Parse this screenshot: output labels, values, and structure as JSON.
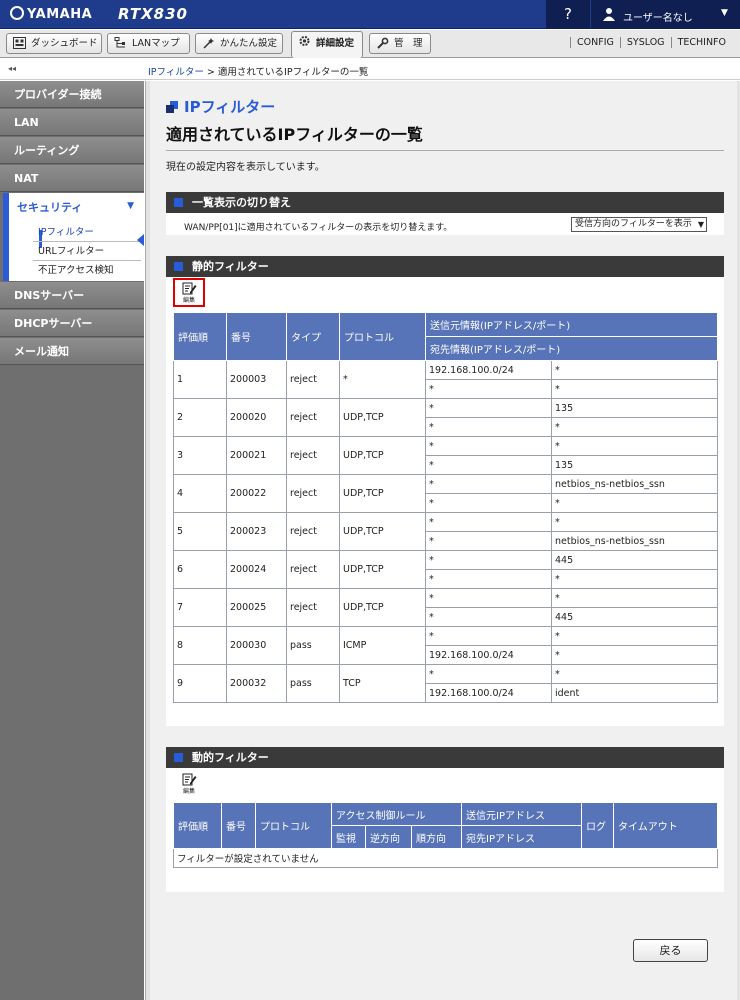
{
  "header": {
    "brand": "YAMAHA",
    "model": "RTX830",
    "help_label": "?",
    "user_name": "ユーザー名なし"
  },
  "tabs": [
    {
      "label": "ダッシュボード",
      "icon": "dashboard-icon"
    },
    {
      "label": "LANマップ",
      "icon": "lanmap-icon"
    },
    {
      "label": "かんたん設定",
      "icon": "wizard-icon"
    },
    {
      "label": "詳細設定",
      "icon": "gear-icon",
      "active": true
    },
    {
      "label": "管　理",
      "icon": "wrench-icon"
    }
  ],
  "top_links": [
    "CONFIG",
    "SYSLOG",
    "TECHINFO"
  ],
  "breadcrumb": {
    "link": "IPフィルター",
    "separator": " > ",
    "current": "適用されているIPフィルターの一覧"
  },
  "collapse_label": "◂◂",
  "sidebar": {
    "items": [
      {
        "label": "プロバイダー接続"
      },
      {
        "label": "LAN"
      },
      {
        "label": "ルーティング"
      },
      {
        "label": "NAT"
      },
      {
        "label": "DNSサーバー"
      },
      {
        "label": "DHCPサーバー"
      },
      {
        "label": "メール通知"
      }
    ],
    "security": {
      "label": "セキュリティ",
      "chevron": "▼",
      "sub_items": [
        "IPフィルター",
        "URLフィルター",
        "不正アクセス検知"
      ]
    }
  },
  "page": {
    "subtitle": "IPフィルター",
    "title": "適用されているIPフィルターの一覧",
    "description": "現在の設定内容を表示しています。"
  },
  "switch_section": {
    "title": "一覧表示の切り替え",
    "text": "WAN/PP[01]に適用されているフィルターの表示を切り替えます。",
    "select_value": "受信方向のフィルターを表示"
  },
  "static_section": {
    "title": "静的フィルター",
    "edit_label": "編集",
    "headers": {
      "order": "評価順",
      "number": "番号",
      "type": "タイプ",
      "protocol": "プロトコル",
      "src": "送信元情報(IPアドレス/ポート)",
      "dst": "宛先情報(IPアドレス/ポート)"
    },
    "rows": [
      {
        "order": "1",
        "number": "200003",
        "type": "reject",
        "protocol": "*",
        "src_ip": "192.168.100.0/24",
        "src_port": "*",
        "dst_ip": "*",
        "dst_port": "*"
      },
      {
        "order": "2",
        "number": "200020",
        "type": "reject",
        "protocol": "UDP,TCP",
        "src_ip": "*",
        "src_port": "135",
        "dst_ip": "*",
        "dst_port": "*"
      },
      {
        "order": "3",
        "number": "200021",
        "type": "reject",
        "protocol": "UDP,TCP",
        "src_ip": "*",
        "src_port": "*",
        "dst_ip": "*",
        "dst_port": "135"
      },
      {
        "order": "4",
        "number": "200022",
        "type": "reject",
        "protocol": "UDP,TCP",
        "src_ip": "*",
        "src_port": "netbios_ns-netbios_ssn",
        "dst_ip": "*",
        "dst_port": "*"
      },
      {
        "order": "5",
        "number": "200023",
        "type": "reject",
        "protocol": "UDP,TCP",
        "src_ip": "*",
        "src_port": "*",
        "dst_ip": "*",
        "dst_port": "netbios_ns-netbios_ssn"
      },
      {
        "order": "6",
        "number": "200024",
        "type": "reject",
        "protocol": "UDP,TCP",
        "src_ip": "*",
        "src_port": "445",
        "dst_ip": "*",
        "dst_port": "*"
      },
      {
        "order": "7",
        "number": "200025",
        "type": "reject",
        "protocol": "UDP,TCP",
        "src_ip": "*",
        "src_port": "*",
        "dst_ip": "*",
        "dst_port": "445"
      },
      {
        "order": "8",
        "number": "200030",
        "type": "pass",
        "protocol": "ICMP",
        "src_ip": "*",
        "src_port": "*",
        "dst_ip": "192.168.100.0/24",
        "dst_port": "*"
      },
      {
        "order": "9",
        "number": "200032",
        "type": "pass",
        "protocol": "TCP",
        "src_ip": "*",
        "src_port": "*",
        "dst_ip": "192.168.100.0/24",
        "dst_port": "ident"
      }
    ]
  },
  "dynamic_section": {
    "title": "動的フィルター",
    "edit_label": "編集",
    "headers": {
      "order": "評価順",
      "number": "番号",
      "protocol": "プロトコル",
      "access_rule": "アクセス制御ルール",
      "monitor": "監視",
      "reverse": "逆方向",
      "forward": "順方向",
      "src_ip": "送信元IPアドレス",
      "dst_ip": "宛先IPアドレス",
      "log": "ログ",
      "timeout": "タイムアウト"
    },
    "empty_message": "フィルターが設定されていません"
  },
  "back_button": "戻る",
  "colors": {
    "header_bg": "#1e3b8c",
    "accent": "#2a5bd8",
    "table_header": "#5874b8",
    "highlight": "#e00000"
  }
}
